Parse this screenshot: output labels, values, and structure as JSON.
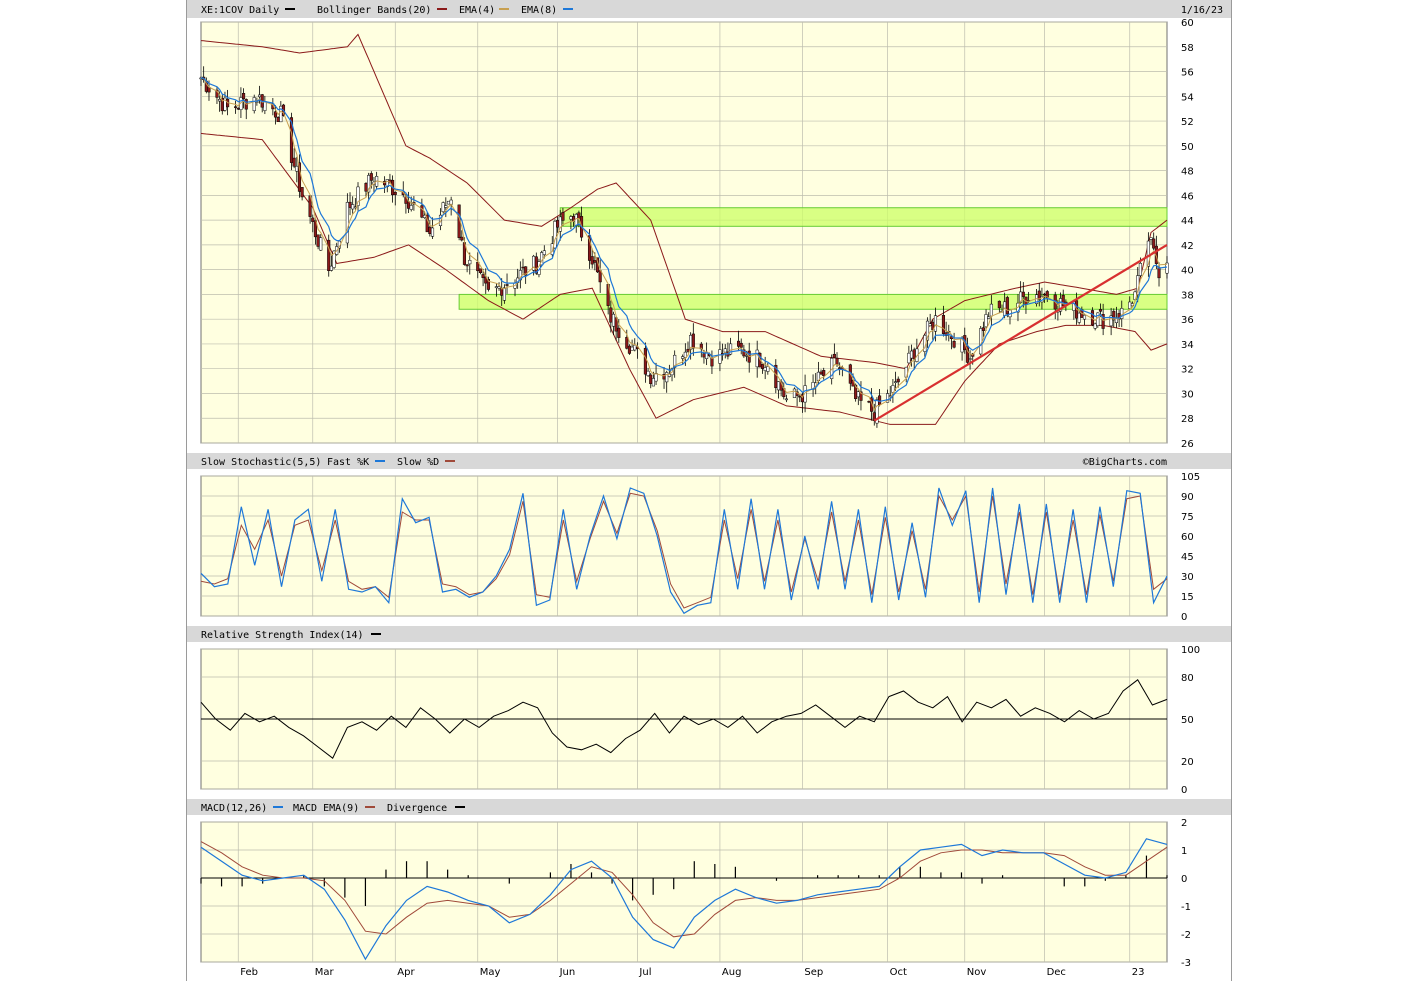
{
  "header": {
    "symbol": "XE:1COV Daily",
    "bollinger_label": "Bollinger Bands(20)",
    "ema4_label": "EMA(4)",
    "ema8_label": "EMA(8)",
    "date": "1/16/23",
    "credit": "©BigCharts.com"
  },
  "colors": {
    "plot_bg": "#ffffe0",
    "grid": "#bdbdae",
    "price_line": "#000000",
    "bollinger": "#8b1a1a",
    "ema4": "#c8a050",
    "ema8": "#1e78d8",
    "fast_k": "#1e78d8",
    "slow_d": "#a04a3a",
    "macd": "#1e78d8",
    "macd_ema": "#a04a3a",
    "zone_fill": "#ccff66",
    "trendline": "#d83030",
    "up_candle": "#ffffff",
    "down_candle": "#8b1a1a"
  },
  "panels": {
    "stochastic_title": "Slow Stochastic(5,5)",
    "fast_k_label": "Fast %K",
    "slow_d_label": "Slow %D",
    "rsi_title": "Relative Strength Index(14)",
    "macd_title": "MACD(12,26)",
    "macd_ema_label": "MACD EMA(9)",
    "divergence_label": "Divergence"
  },
  "chart_data": [
    {
      "type": "candlestick",
      "name": "price",
      "ylim": [
        26,
        60
      ],
      "yticks": [
        "60",
        "58",
        "56",
        "54",
        "52",
        "50",
        "48",
        "46",
        "44",
        "42",
        "40",
        "38",
        "36",
        "34",
        "32",
        "30",
        "28",
        "26"
      ],
      "months": [
        "Feb",
        "Mar",
        "Apr",
        "May",
        "Jun",
        "Jul",
        "Aug",
        "Sep",
        "Oct",
        "Nov",
        "Dec",
        "23"
      ],
      "x_start": "2022-01-18",
      "x_end": "2023-01-16",
      "close_anchors": [
        [
          "2022-01-18",
          55.5
        ],
        [
          "2022-01-28",
          53.0
        ],
        [
          "2022-02-08",
          54.0
        ],
        [
          "2022-02-17",
          52.5
        ],
        [
          "2022-02-25",
          46.0
        ],
        [
          "2022-03-07",
          40.0
        ],
        [
          "2022-03-14",
          45.0
        ],
        [
          "2022-03-24",
          47.5
        ],
        [
          "2022-04-05",
          46.0
        ],
        [
          "2022-04-14",
          43.0
        ],
        [
          "2022-04-22",
          46.0
        ],
        [
          "2022-04-27",
          41.0
        ],
        [
          "2022-05-06",
          38.0
        ],
        [
          "2022-05-17",
          39.5
        ],
        [
          "2022-05-24",
          40.5
        ],
        [
          "2022-06-01",
          43.5
        ],
        [
          "2022-06-07",
          44.5
        ],
        [
          "2022-06-14",
          41.0
        ],
        [
          "2022-06-20",
          36.5
        ],
        [
          "2022-06-28",
          34.0
        ],
        [
          "2022-07-06",
          31.5
        ],
        [
          "2022-07-13",
          32.0
        ],
        [
          "2022-07-21",
          34.5
        ],
        [
          "2022-07-29",
          33.0
        ],
        [
          "2022-08-09",
          33.5
        ],
        [
          "2022-08-19",
          32.5
        ],
        [
          "2022-08-26",
          29.5
        ],
        [
          "2022-09-02",
          30.0
        ],
        [
          "2022-09-09",
          31.5
        ],
        [
          "2022-09-14",
          32.5
        ],
        [
          "2022-09-21",
          29.5
        ],
        [
          "2022-09-28",
          28.5
        ],
        [
          "2022-10-06",
          30.5
        ],
        [
          "2022-10-13",
          33.5
        ],
        [
          "2022-10-21",
          36.0
        ],
        [
          "2022-10-28",
          34.5
        ],
        [
          "2022-11-03",
          33.0
        ],
        [
          "2022-11-10",
          36.5
        ],
        [
          "2022-11-18",
          37.0
        ],
        [
          "2022-11-25",
          38.0
        ],
        [
          "2022-12-02",
          38.0
        ],
        [
          "2022-12-09",
          37.0
        ],
        [
          "2022-12-16",
          36.5
        ],
        [
          "2022-12-23",
          36.0
        ],
        [
          "2022-12-30",
          36.5
        ],
        [
          "2023-01-04",
          38.0
        ],
        [
          "2023-01-09",
          42.5
        ],
        [
          "2023-01-13",
          40.0
        ],
        [
          "2023-01-16",
          41.0
        ]
      ],
      "bollinger_upper_anchors": [
        [
          "2022-01-18",
          58.5
        ],
        [
          "2022-02-10",
          58.0
        ],
        [
          "2022-02-24",
          57.5
        ],
        [
          "2022-03-14",
          58.0
        ],
        [
          "2022-03-18",
          59.0
        ],
        [
          "2022-03-28",
          54.0
        ],
        [
          "2022-04-05",
          50.0
        ],
        [
          "2022-04-14",
          49.0
        ],
        [
          "2022-04-28",
          47.0
        ],
        [
          "2022-05-12",
          44.0
        ],
        [
          "2022-05-26",
          43.5
        ],
        [
          "2022-06-06",
          45.0
        ],
        [
          "2022-06-16",
          46.5
        ],
        [
          "2022-06-23",
          47.0
        ],
        [
          "2022-07-06",
          44.0
        ],
        [
          "2022-07-19",
          36.0
        ],
        [
          "2022-08-02",
          35.0
        ],
        [
          "2022-08-18",
          35.0
        ],
        [
          "2022-09-08",
          33.0
        ],
        [
          "2022-09-28",
          32.5
        ],
        [
          "2022-10-10",
          32.0
        ],
        [
          "2022-10-20",
          36.0
        ],
        [
          "2022-11-01",
          37.5
        ],
        [
          "2022-11-20",
          38.5
        ],
        [
          "2022-12-01",
          39.0
        ],
        [
          "2022-12-15",
          38.5
        ],
        [
          "2022-12-28",
          38.0
        ],
        [
          "2023-01-05",
          38.5
        ],
        [
          "2023-01-10",
          43.0
        ],
        [
          "2023-01-16",
          44.0
        ]
      ],
      "bollinger_lower_anchors": [
        [
          "2022-01-18",
          51.0
        ],
        [
          "2022-02-10",
          50.5
        ],
        [
          "2022-03-01",
          45.0
        ],
        [
          "2022-03-10",
          40.5
        ],
        [
          "2022-03-24",
          41.0
        ],
        [
          "2022-04-06",
          42.0
        ],
        [
          "2022-04-20",
          40.0
        ],
        [
          "2022-05-06",
          37.5
        ],
        [
          "2022-05-19",
          36.0
        ],
        [
          "2022-06-02",
          38.0
        ],
        [
          "2022-06-14",
          38.5
        ],
        [
          "2022-06-28",
          32.0
        ],
        [
          "2022-07-08",
          28.0
        ],
        [
          "2022-07-22",
          29.5
        ],
        [
          "2022-08-10",
          30.5
        ],
        [
          "2022-08-26",
          29.0
        ],
        [
          "2022-09-15",
          28.5
        ],
        [
          "2022-10-04",
          27.5
        ],
        [
          "2022-10-21",
          27.5
        ],
        [
          "2022-11-01",
          31.0
        ],
        [
          "2022-11-14",
          34.0
        ],
        [
          "2022-11-28",
          35.0
        ],
        [
          "2022-12-09",
          35.5
        ],
        [
          "2022-12-23",
          35.5
        ],
        [
          "2023-01-04",
          35.0
        ],
        [
          "2023-01-10",
          33.5
        ],
        [
          "2023-01-16",
          34.0
        ]
      ],
      "zones": [
        {
          "from": "2022-06-02",
          "to": "2023-01-16",
          "low": 43.5,
          "high": 45.0
        },
        {
          "from": "2022-04-25",
          "to": "2023-01-16",
          "low": 36.8,
          "high": 38.0
        }
      ],
      "trendline": {
        "from": [
          "2022-09-28",
          27.8
        ],
        "to": [
          "2023-01-16",
          42.0
        ]
      }
    },
    {
      "type": "line",
      "name": "stochastic",
      "ylim": [
        0,
        105
      ],
      "yticks": [
        "105",
        "90",
        "75",
        "60",
        "45",
        "30",
        "15",
        "0"
      ],
      "series": [
        {
          "name": "Fast %K",
          "values": [
            32,
            22,
            24,
            82,
            38,
            80,
            22,
            72,
            80,
            26,
            80,
            20,
            18,
            22,
            10,
            88,
            70,
            74,
            18,
            20,
            14,
            18,
            30,
            50,
            92,
            8,
            12,
            80,
            20,
            60,
            90,
            58,
            96,
            92,
            60,
            18,
            2,
            8,
            10,
            80,
            20,
            88,
            20,
            80,
            12,
            60,
            20,
            86,
            20,
            80,
            10,
            82,
            12,
            70,
            14,
            96,
            68,
            94,
            10,
            96,
            16,
            84,
            10,
            84,
            10,
            80,
            10,
            82,
            22,
            94,
            92,
            10,
            30
          ]
        },
        {
          "name": "Slow %D",
          "values": [
            26,
            24,
            28,
            68,
            50,
            72,
            30,
            68,
            72,
            34,
            72,
            26,
            20,
            22,
            14,
            78,
            72,
            72,
            24,
            22,
            16,
            18,
            28,
            46,
            86,
            16,
            14,
            72,
            26,
            58,
            86,
            62,
            92,
            90,
            64,
            24,
            6,
            10,
            14,
            72,
            28,
            80,
            26,
            72,
            18,
            58,
            26,
            78,
            26,
            72,
            16,
            74,
            18,
            64,
            20,
            90,
            72,
            90,
            18,
            90,
            24,
            78,
            16,
            78,
            16,
            72,
            16,
            76,
            26,
            88,
            90,
            20,
            28
          ]
        }
      ]
    },
    {
      "type": "line",
      "name": "rsi",
      "ylim": [
        0,
        100
      ],
      "yticks": [
        "100",
        "80",
        "50",
        "20",
        "0"
      ],
      "series": [
        {
          "name": "RSI(14)",
          "values": [
            62,
            50,
            42,
            54,
            48,
            52,
            44,
            38,
            30,
            22,
            44,
            48,
            42,
            52,
            44,
            58,
            50,
            40,
            50,
            44,
            52,
            56,
            62,
            58,
            40,
            30,
            28,
            32,
            26,
            36,
            42,
            54,
            40,
            52,
            46,
            50,
            44,
            52,
            40,
            48,
            52,
            54,
            60,
            52,
            44,
            52,
            48,
            66,
            70,
            62,
            58,
            66,
            48,
            62,
            58,
            64,
            52,
            58,
            54,
            48,
            56,
            50,
            54,
            70,
            78,
            60,
            64
          ]
        }
      ]
    },
    {
      "type": "line",
      "name": "macd",
      "ylim": [
        -3,
        2
      ],
      "yticks": [
        "2",
        "1",
        "0",
        "-1",
        "-2",
        "-3"
      ],
      "series": [
        {
          "name": "MACD(12,26)",
          "values": [
            1.1,
            0.6,
            0.1,
            -0.1,
            0.0,
            0.1,
            -0.4,
            -1.5,
            -2.9,
            -1.7,
            -0.8,
            -0.3,
            -0.5,
            -0.8,
            -1.0,
            -1.6,
            -1.3,
            -0.6,
            0.3,
            0.6,
            0.0,
            -1.4,
            -2.2,
            -2.5,
            -1.4,
            -0.8,
            -0.4,
            -0.7,
            -0.9,
            -0.8,
            -0.6,
            -0.5,
            -0.4,
            -0.3,
            0.4,
            1.0,
            1.1,
            1.2,
            0.8,
            1.0,
            0.9,
            0.9,
            0.5,
            0.1,
            0.0,
            0.2,
            1.4,
            1.2
          ]
        },
        {
          "name": "MACD EMA(9)",
          "values": [
            1.3,
            0.9,
            0.4,
            0.1,
            0.0,
            0.0,
            -0.1,
            -0.8,
            -1.9,
            -2.0,
            -1.4,
            -0.9,
            -0.8,
            -0.9,
            -1.0,
            -1.4,
            -1.3,
            -0.8,
            -0.2,
            0.4,
            0.2,
            -0.6,
            -1.6,
            -2.1,
            -2.0,
            -1.3,
            -0.8,
            -0.7,
            -0.8,
            -0.8,
            -0.7,
            -0.6,
            -0.5,
            -0.4,
            0.0,
            0.6,
            0.9,
            1.0,
            1.0,
            0.9,
            0.9,
            0.9,
            0.8,
            0.4,
            0.1,
            0.1,
            0.6,
            1.1
          ]
        },
        {
          "name": "Divergence",
          "values": [
            -0.2,
            -0.3,
            -0.3,
            -0.2,
            0.0,
            0.1,
            -0.3,
            -0.7,
            -1.0,
            0.3,
            0.6,
            0.6,
            0.3,
            0.1,
            0.0,
            -0.2,
            0.0,
            0.2,
            0.5,
            0.2,
            -0.2,
            -0.8,
            -0.6,
            -0.4,
            0.6,
            0.5,
            0.4,
            0.0,
            -0.1,
            0.0,
            0.1,
            0.1,
            0.1,
            0.1,
            0.4,
            0.4,
            0.2,
            0.2,
            -0.2,
            0.1,
            0.0,
            0.0,
            -0.3,
            -0.3,
            -0.1,
            0.1,
            0.8,
            0.1
          ]
        }
      ]
    }
  ]
}
